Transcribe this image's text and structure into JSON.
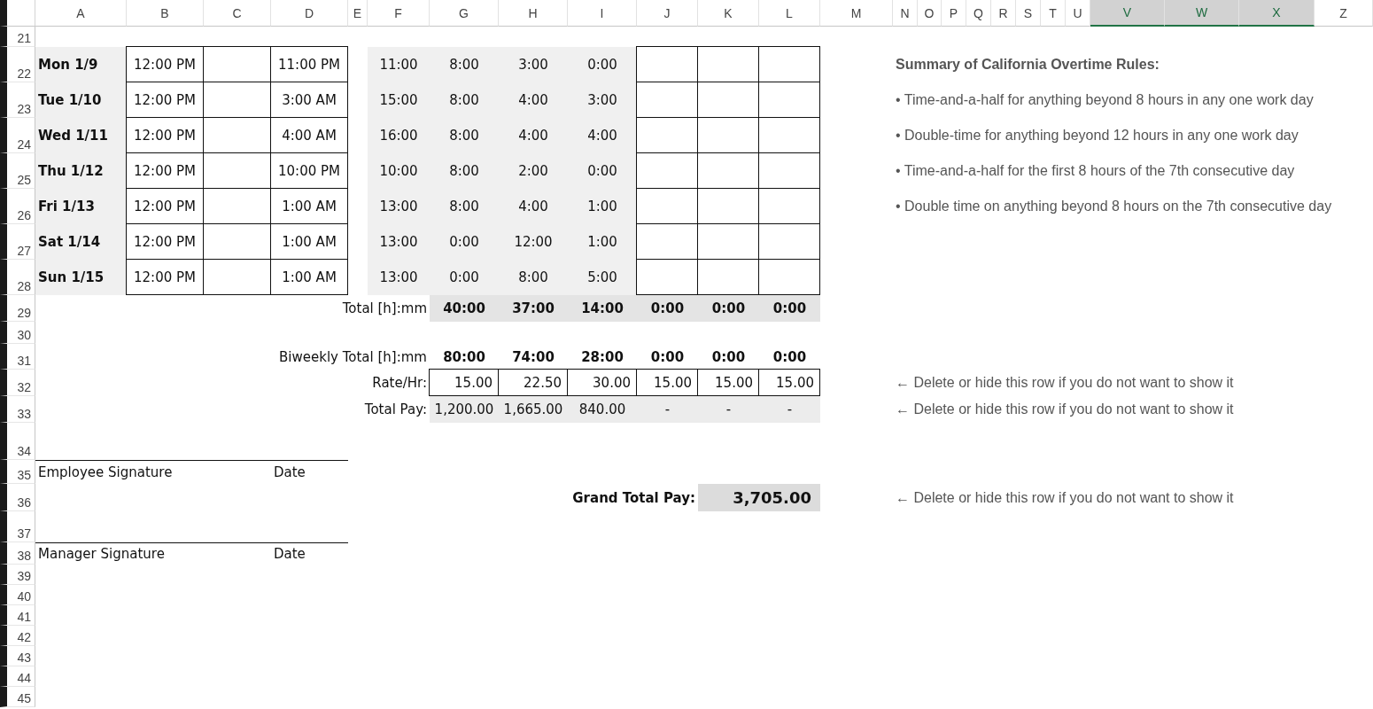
{
  "column_headers": [
    {
      "label": "A",
      "selected": false
    },
    {
      "label": "B",
      "selected": false
    },
    {
      "label": "C",
      "selected": false
    },
    {
      "label": "D",
      "selected": false
    },
    {
      "label": "E",
      "selected": false
    },
    {
      "label": "F",
      "selected": false
    },
    {
      "label": "G",
      "selected": false
    },
    {
      "label": "H",
      "selected": false
    },
    {
      "label": "I",
      "selected": false
    },
    {
      "label": "J",
      "selected": false
    },
    {
      "label": "K",
      "selected": false
    },
    {
      "label": "L",
      "selected": false
    },
    {
      "label": "M",
      "selected": false
    },
    {
      "label": "N",
      "selected": false
    },
    {
      "label": "O",
      "selected": false
    },
    {
      "label": "P",
      "selected": false
    },
    {
      "label": "Q",
      "selected": false
    },
    {
      "label": "R",
      "selected": false
    },
    {
      "label": "S",
      "selected": false
    },
    {
      "label": "T",
      "selected": false
    },
    {
      "label": "U",
      "selected": false
    },
    {
      "label": "V",
      "selected": true
    },
    {
      "label": "W",
      "selected": true
    },
    {
      "label": "X",
      "selected": true
    },
    {
      "label": "Z",
      "selected": false
    }
  ],
  "row_numbers": [
    "21",
    "22",
    "23",
    "24",
    "25",
    "26",
    "27",
    "28",
    "29",
    "30",
    "31",
    "32",
    "33",
    "34",
    "35",
    "36",
    "37",
    "38",
    "39",
    "40",
    "41",
    "42",
    "43",
    "44",
    "45"
  ],
  "days": [
    {
      "day": "Mon 1/9",
      "col_b": "12:00 PM",
      "col_d": "11:00 PM",
      "col_f": "11:00",
      "col_g": "8:00",
      "col_h": "3:00",
      "col_i": "0:00"
    },
    {
      "day": "Tue 1/10",
      "col_b": "12:00 PM",
      "col_d": "3:00 AM",
      "col_f": "15:00",
      "col_g": "8:00",
      "col_h": "4:00",
      "col_i": "3:00"
    },
    {
      "day": "Wed 1/11",
      "col_b": "12:00 PM",
      "col_d": "4:00 AM",
      "col_f": "16:00",
      "col_g": "8:00",
      "col_h": "4:00",
      "col_i": "4:00"
    },
    {
      "day": "Thu 1/12",
      "col_b": "12:00 PM",
      "col_d": "10:00 PM",
      "col_f": "10:00",
      "col_g": "8:00",
      "col_h": "2:00",
      "col_i": "0:00"
    },
    {
      "day": "Fri 1/13",
      "col_b": "12:00 PM",
      "col_d": "1:00 AM",
      "col_f": "13:00",
      "col_g": "8:00",
      "col_h": "4:00",
      "col_i": "1:00"
    },
    {
      "day": "Sat 1/14",
      "col_b": "12:00 PM",
      "col_d": "1:00 AM",
      "col_f": "13:00",
      "col_g": "0:00",
      "col_h": "12:00",
      "col_i": "1:00"
    },
    {
      "day": "Sun 1/15",
      "col_b": "12:00 PM",
      "col_d": "1:00 AM",
      "col_f": "13:00",
      "col_g": "0:00",
      "col_h": "8:00",
      "col_i": "5:00"
    }
  ],
  "total": {
    "label": "Total [h]:mm",
    "values": [
      "40:00",
      "37:00",
      "14:00",
      "0:00",
      "0:00",
      "0:00"
    ]
  },
  "biweekly_total": {
    "label": "Biweekly Total [h]:mm",
    "values": [
      "80:00",
      "74:00",
      "28:00",
      "0:00",
      "0:00",
      "0:00"
    ]
  },
  "rate": {
    "label": "Rate/Hr:",
    "values": [
      "15.00",
      "22.50",
      "30.00",
      "15.00",
      "15.00",
      "15.00"
    ]
  },
  "total_pay": {
    "label": "Total Pay:",
    "values": [
      "1,200.00",
      "1,665.00",
      "840.00",
      "-",
      "-",
      "-"
    ]
  },
  "signatures": [
    {
      "label": "Employee Signature",
      "date_label": "Date"
    },
    {
      "label": "Manager Signature",
      "date_label": "Date"
    }
  ],
  "grand_total": {
    "label": "Grand Total Pay:",
    "value": "3,705.00"
  },
  "summary": {
    "title": "Summary of California Overtime Rules:",
    "rules": [
      "• Time-and-a-half for anything beyond 8 hours in any one work day",
      "• Double-time for anything beyond 12 hours in any one work day",
      "• Time-and-a-half for the first 8 hours of the 7th consecutive day",
      "• Double time on anything beyond 8 hours on the 7th consecutive day"
    ]
  },
  "row_notes": [
    "← Delete or hide this row if you do not want to show it",
    "← Delete or hide this row if you do not want to show it",
    "← Delete or hide this row if you do not want to show it"
  ]
}
